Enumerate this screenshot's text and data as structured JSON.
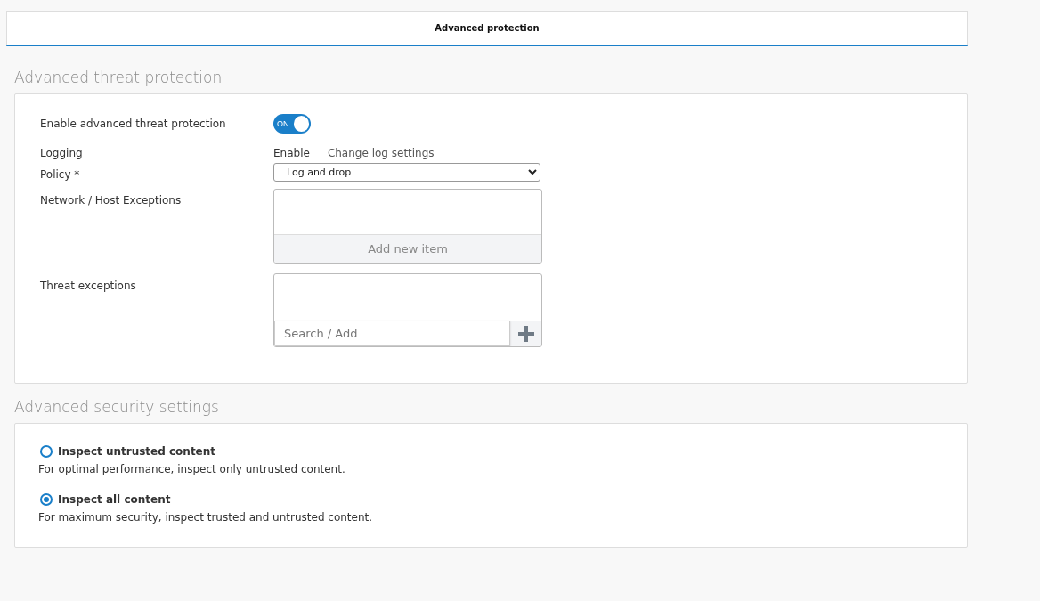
{
  "tabs": [
    {
      "label": "Advanced protection",
      "selected": true
    }
  ],
  "sections": [
    {
      "title": "Advanced threat protection",
      "fields": [
        {
          "kind": "toggle",
          "label": "Enable advanced threat protection",
          "on": true,
          "text": "ON"
        },
        {
          "kind": "logging",
          "label": "Logging",
          "value": "Enable",
          "link": "Change log settings"
        },
        {
          "kind": "select",
          "label": "Policy *",
          "value": "Log and drop"
        },
        {
          "kind": "list",
          "label": "Network / Host Exceptions",
          "button": "Add new item"
        },
        {
          "kind": "search-list",
          "label": "Threat exceptions",
          "placeholder": "Search / Add"
        }
      ]
    },
    {
      "title": "Advanced security settings",
      "options": [
        {
          "label": "Inspect untrusted content",
          "description": "For optimal performance, inspect only untrusted content.",
          "selected": false
        },
        {
          "label": "Inspect all content",
          "description": "For maximum security, inspect trusted and untrusted content.",
          "selected": true
        }
      ]
    }
  ]
}
